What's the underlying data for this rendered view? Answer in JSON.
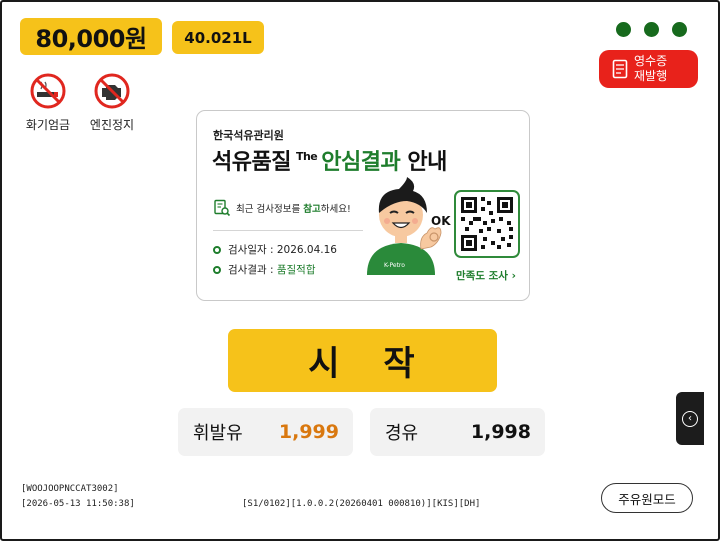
{
  "header": {
    "amount": "80,000원",
    "volume": "40.021L"
  },
  "notices": [
    {
      "icon": "no-smoking-icon",
      "label": "화기엄금"
    },
    {
      "icon": "engine-off-icon",
      "label": "엔진정지"
    }
  ],
  "status_dots": {
    "count": 3,
    "color": "#176a1d"
  },
  "receipt_button": {
    "line1": "영수증",
    "line2": "재발행",
    "color": "#e8221b"
  },
  "banner": {
    "org": "한국석유관리원",
    "title_main": "석유품질",
    "title_the": "The",
    "title_green": "안심결과",
    "title_end": "안내",
    "tip_prefix": "최근 검사정보를 ",
    "tip_highlight": "참고",
    "tip_suffix": "하세요!",
    "ok_text": "OK",
    "mascot_shirt": "K-Petro",
    "inspection_date_label": "검사일자 : ",
    "inspection_date": "2026.04.16",
    "inspection_result_label": "검사결과 : ",
    "inspection_result": "품질적합",
    "survey_link": "만족도 조사 ›"
  },
  "start_button": "시 작",
  "prices": [
    {
      "name": "휘발유",
      "value": "1,999",
      "color": "#d9780f"
    },
    {
      "name": "경유",
      "value": "1,998",
      "color": "#111111"
    }
  ],
  "side_tab_icon": "chevron-left-circle-icon",
  "footer": {
    "terminal_id": "[WOOJOOPNCCAT3002]",
    "datetime": "[2026-05-13 11:50:38]",
    "version": "[S1/0102][1.0.0.2(20260401 000810)][KIS][DH]",
    "mode_button": "주유원모드"
  },
  "colors": {
    "accent": "#f6c21a",
    "green": "#1e7d2c",
    "red": "#e8221b"
  }
}
